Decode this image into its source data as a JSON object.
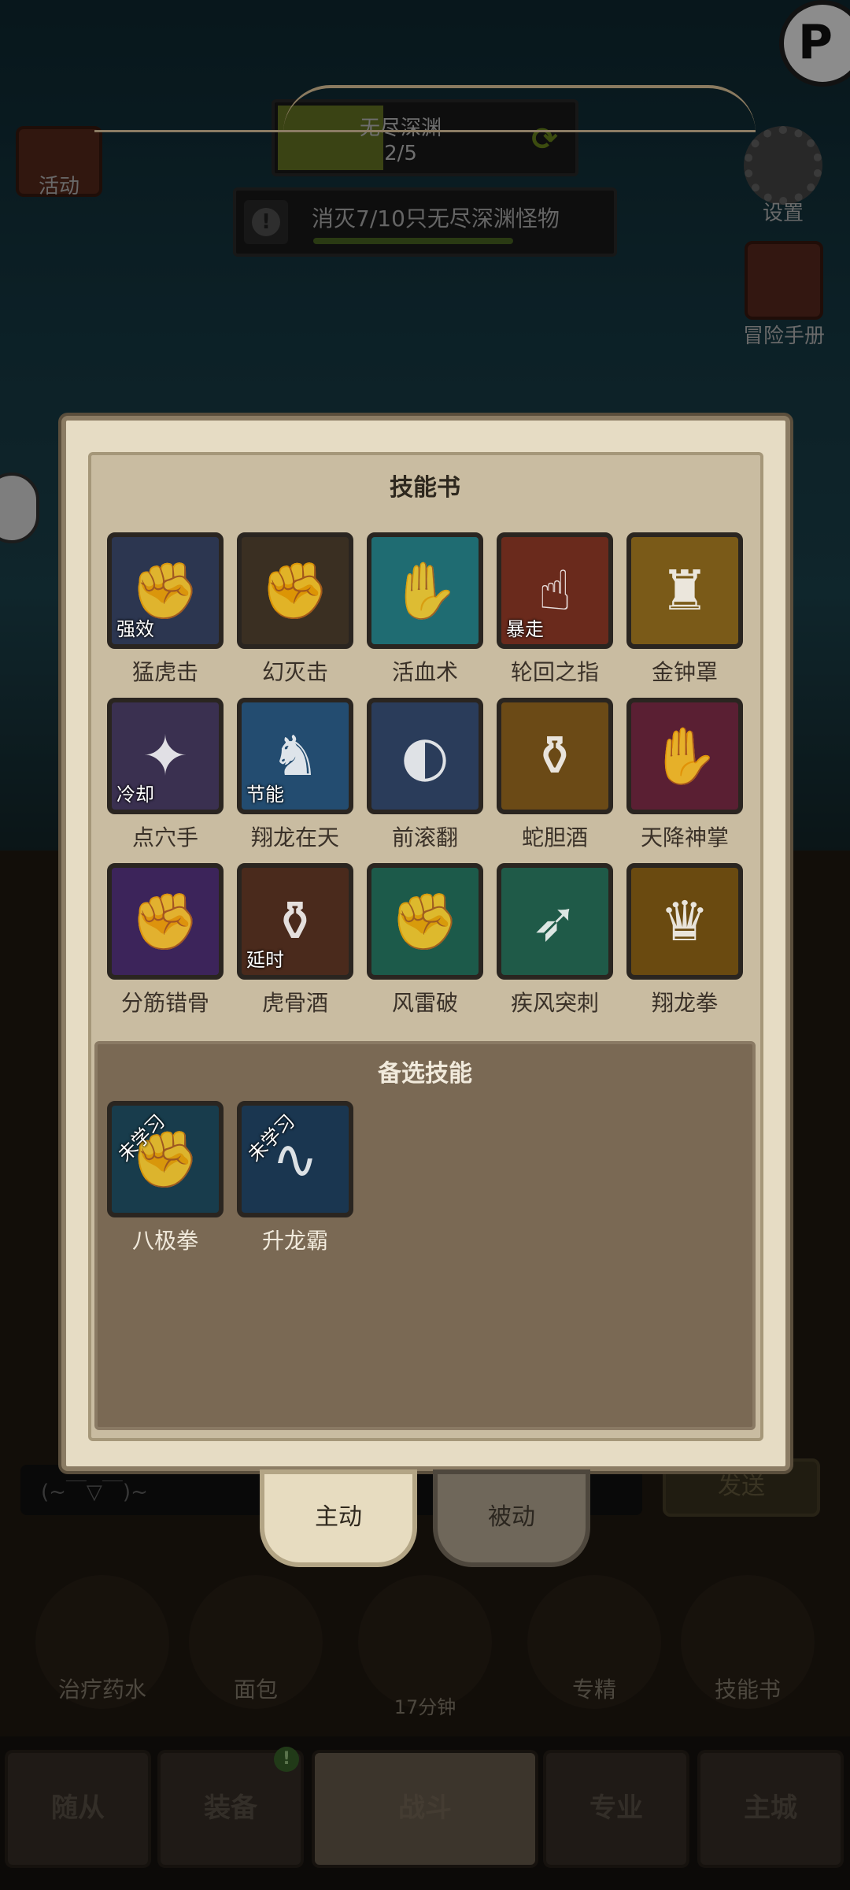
{
  "hud": {
    "abyss_title": "无尽深渊",
    "abyss_progress": "2/5",
    "abyss_fill_ratio": 0.35,
    "quest_text": "消灭7/10只无尽深渊怪物",
    "quest_progress_ratio": 0.7
  },
  "side": {
    "activity": "活动",
    "settings": "设置",
    "handbook": "冒险手册"
  },
  "panel": {
    "title": "技能书",
    "skills": [
      {
        "name": "猛虎击",
        "tag": "强效",
        "icon": "fist-icon",
        "color": "#2c3650"
      },
      {
        "name": "幻灭击",
        "tag": "",
        "icon": "dark-fist-icon",
        "color": "#3a2f22"
      },
      {
        "name": "活血术",
        "tag": "",
        "icon": "glowing-hand-icon",
        "color": "#1f6c72"
      },
      {
        "name": "轮回之指",
        "tag": "暴走",
        "icon": "flame-finger-icon",
        "color": "#6a2a1c"
      },
      {
        "name": "金钟罩",
        "tag": "",
        "icon": "golden-bell-icon",
        "color": "#7a5a18"
      },
      {
        "name": "点穴手",
        "tag": "冷却",
        "icon": "pressure-point-icon",
        "color": "#3a3050"
      },
      {
        "name": "翔龙在天",
        "tag": "节能",
        "icon": "dragon-icon",
        "color": "#234c70"
      },
      {
        "name": "前滚翻",
        "tag": "",
        "icon": "roll-icon",
        "color": "#2a3c5a"
      },
      {
        "name": "蛇胆酒",
        "tag": "",
        "icon": "wine-vessel-icon",
        "color": "#6b4a16"
      },
      {
        "name": "天降神掌",
        "tag": "",
        "icon": "divine-palm-icon",
        "color": "#5a1f33"
      },
      {
        "name": "分筋错骨",
        "tag": "",
        "icon": "twisting-hands-icon",
        "color": "#3c245a"
      },
      {
        "name": "虎骨酒",
        "tag": "延时",
        "icon": "tiger-wine-icon",
        "color": "#4a2a1c"
      },
      {
        "name": "风雷破",
        "tag": "",
        "icon": "thunder-fist-icon",
        "color": "#1c5a4a"
      },
      {
        "name": "疾风突刺",
        "tag": "",
        "icon": "dash-icon",
        "color": "#1f5a48"
      },
      {
        "name": "翔龙拳",
        "tag": "",
        "icon": "dragon-fist-icon",
        "color": "#6a4a10"
      }
    ],
    "alt_title": "备选技能",
    "alt_skills": [
      {
        "name": "八极拳",
        "tag": "未学习",
        "icon": "bagua-fist-icon",
        "color": "#183c4c"
      },
      {
        "name": "升龙霸",
        "tag": "未学习",
        "icon": "rising-dragon-icon",
        "color": "#1a3650"
      }
    ]
  },
  "tabs": {
    "active": "主动",
    "passive": "被动"
  },
  "chat": {
    "placeholder": "(~￣▽￣)~",
    "send": "发送"
  },
  "quick": [
    {
      "label": "治疗药水",
      "icon": "potion-icon"
    },
    {
      "label": "面包",
      "icon": "bread-icon"
    },
    {
      "label": "",
      "sub": "17分钟",
      "icon": "treasure-chest-icon"
    },
    {
      "label": "专精",
      "icon": "specialization-icon"
    },
    {
      "label": "技能书",
      "icon": "skill-book-icon"
    }
  ],
  "nav": [
    {
      "label": "随从"
    },
    {
      "label": "装备",
      "badge": "!"
    },
    {
      "label": "战斗"
    },
    {
      "label": "专业"
    },
    {
      "label": "主城"
    }
  ]
}
